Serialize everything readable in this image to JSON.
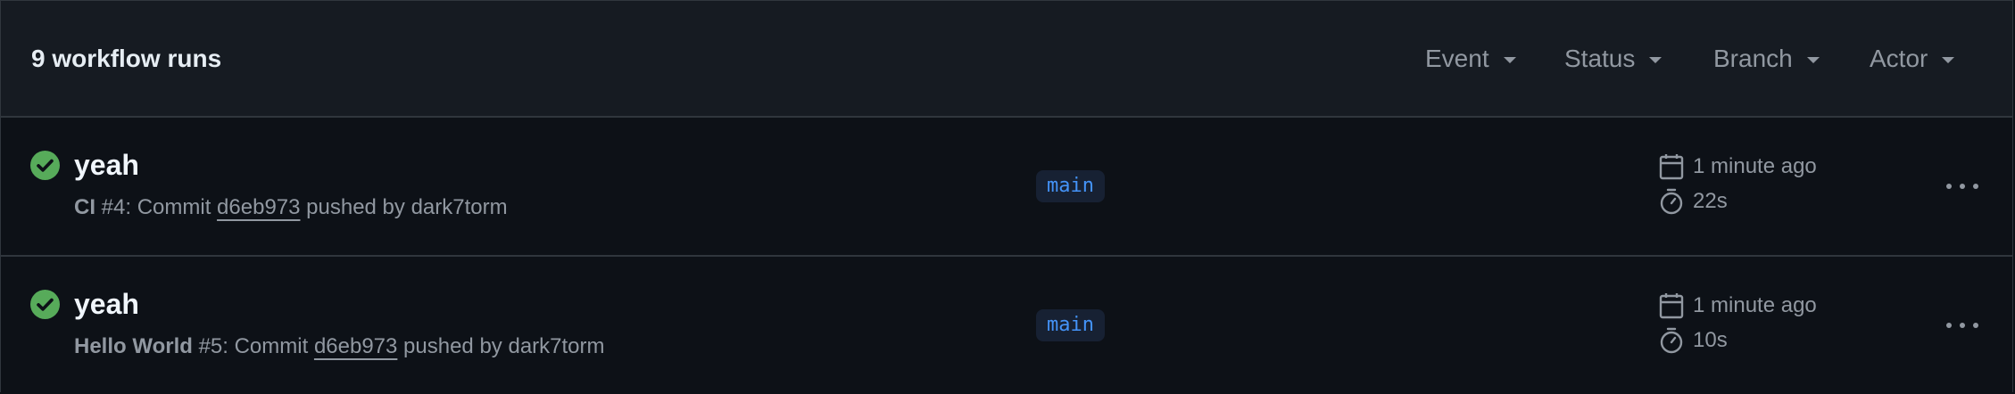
{
  "header": {
    "runs_count": "9 workflow runs",
    "filters": [
      "Event",
      "Status",
      "Branch",
      "Actor"
    ]
  },
  "runs": [
    {
      "title": "yeah",
      "workflow": "CI",
      "run_number": "#4",
      "meta_prefix": ": Commit ",
      "sha": "d6eb973",
      "meta_suffix": " pushed by dark7torm",
      "branch": "main",
      "time_ago": "1 minute ago",
      "duration": "22s",
      "status": "success"
    },
    {
      "title": "yeah",
      "workflow": "Hello World",
      "run_number": "#5",
      "meta_prefix": ": Commit ",
      "sha": "d6eb973",
      "meta_suffix": " pushed by dark7torm",
      "branch": "main",
      "time_ago": "1 minute ago",
      "duration": "10s",
      "status": "success"
    }
  ],
  "colors": {
    "success": "#57ab5a",
    "branch_text": "#4493f8",
    "muted": "#9198a1"
  },
  "icons": [
    "check-circle-icon",
    "calendar-icon",
    "stopwatch-icon",
    "kebab-horizontal-icon",
    "triangle-down-icon"
  ]
}
